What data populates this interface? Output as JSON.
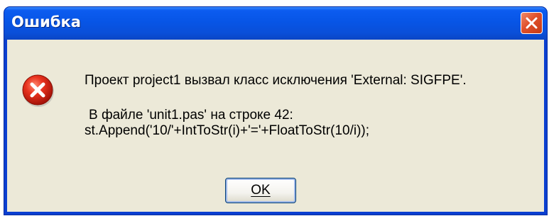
{
  "dialog": {
    "title": "Ошибка",
    "icon": "error-icon",
    "message": {
      "line1": "Проект project1 вызвал класс исключения 'External: SIGFPE'.",
      "line2": "В файле 'unit1.pas' на строке 42:",
      "line3": "st.Append('10/'+IntToStr(i)+'='+FloatToStr(10/i));"
    },
    "buttons": {
      "ok_label": "OK"
    },
    "colors": {
      "titlebar": "#0755e6",
      "client": "#ece9d8",
      "close_button": "#e0502a",
      "error_icon": "#d9281a"
    }
  }
}
